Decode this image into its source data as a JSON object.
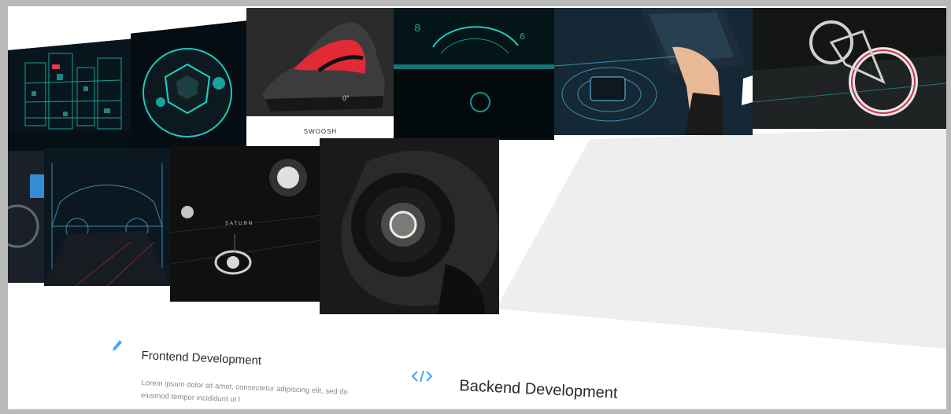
{
  "gallery": {
    "tiles": [
      {
        "id": "city",
        "label": ""
      },
      {
        "id": "ball",
        "label": ""
      },
      {
        "id": "shoe",
        "label": "SWOOSH"
      },
      {
        "id": "helmet",
        "label": ""
      },
      {
        "id": "laptop",
        "label": ""
      },
      {
        "id": "bike",
        "label": ""
      },
      {
        "id": "edge",
        "label": ""
      },
      {
        "id": "car",
        "label": ""
      },
      {
        "id": "saturn",
        "label": "SATURN"
      },
      {
        "id": "speaker",
        "label": ""
      }
    ]
  },
  "services": {
    "accent_color": "#3aa7ff",
    "items": [
      {
        "icon": "pencil-icon",
        "title": "Frontend Development",
        "description": "Lorem ipsum dolor sit amet, consectetur adipiscing elit, sed do eiusmod tempor incididunt ut l"
      },
      {
        "icon": "code-icon",
        "title": "Backend Development",
        "description": ""
      }
    ]
  }
}
